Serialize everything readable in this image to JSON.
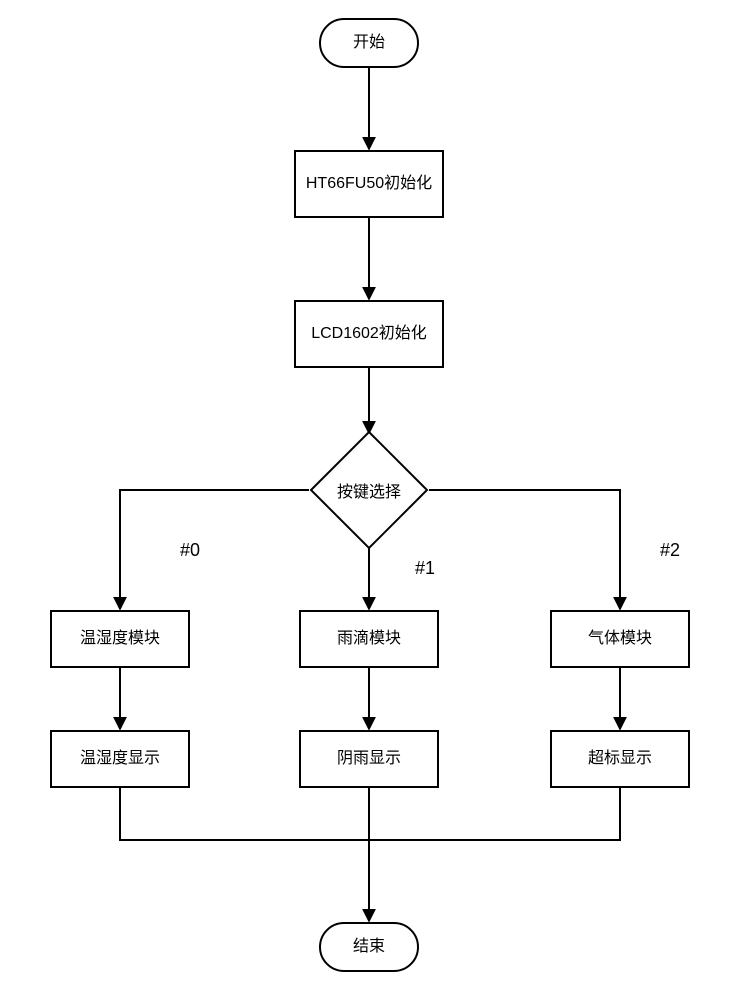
{
  "flow": {
    "start": "开始",
    "init_mcu": "HT66FU50初始化",
    "init_lcd": "LCD1602初始化",
    "decision": "按键选择",
    "branch0_label": "#0",
    "branch1_label": "#1",
    "branch2_label": "#2",
    "branch0_module": "温湿度模块",
    "branch1_module": "雨滴模块",
    "branch2_module": "气体模块",
    "branch0_display": "温湿度显示",
    "branch1_display": "阴雨显示",
    "branch2_display": "超标显示",
    "end": "结束"
  }
}
